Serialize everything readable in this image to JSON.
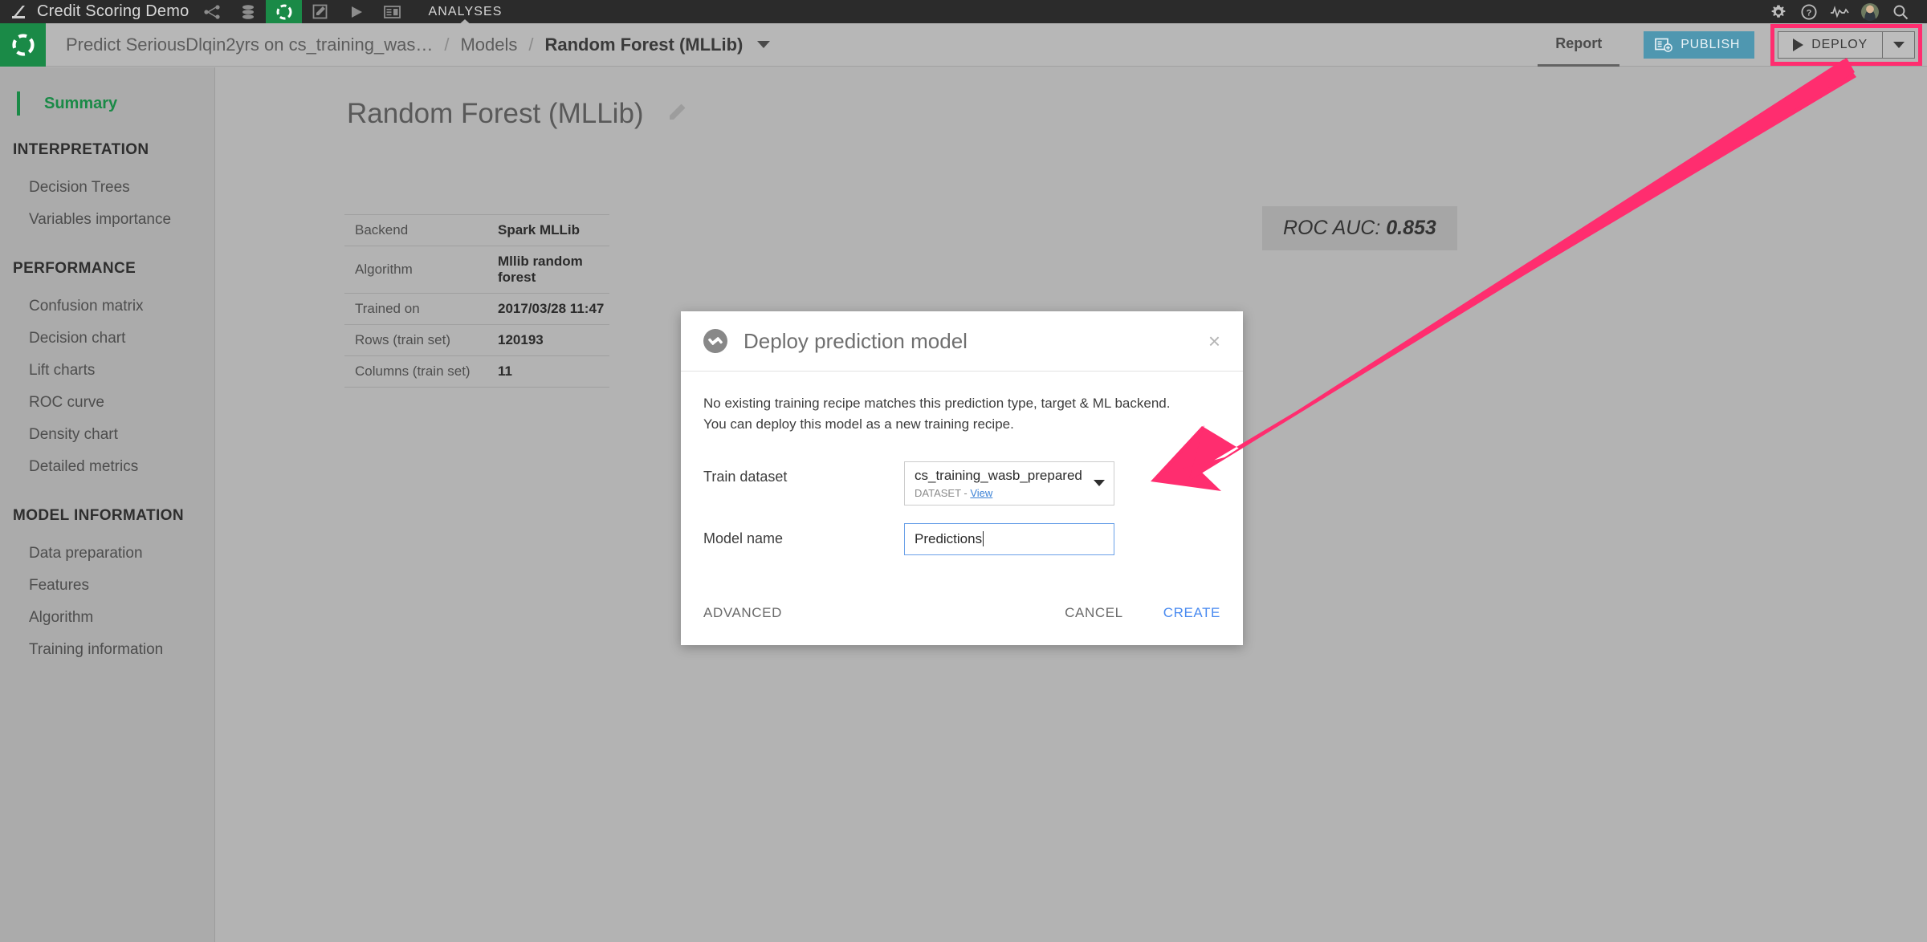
{
  "topbar": {
    "logo_icon": "dataiku-logo-icon",
    "project_name": "Credit Scoring Demo",
    "icons": [
      {
        "name": "flow-icon",
        "active": false
      },
      {
        "name": "datasets-icon",
        "active": false
      },
      {
        "name": "lab-analyses-icon",
        "active": true
      },
      {
        "name": "notebooks-icon",
        "active": false
      },
      {
        "name": "jobs-run-icon",
        "active": false
      },
      {
        "name": "dashboards-icon",
        "active": false
      }
    ],
    "section_label": "ANALYSES",
    "right_icons": [
      {
        "name": "gear-icon"
      },
      {
        "name": "help-icon"
      },
      {
        "name": "activity-icon"
      },
      {
        "name": "avatar"
      },
      {
        "name": "search-icon"
      }
    ]
  },
  "navbar": {
    "logo_icon": "project-logo-icon",
    "breadcrumb": {
      "analysis": "Predict SeriousDlqin2yrs on cs_training_was…",
      "separator": "/",
      "section": "Models",
      "current": "Random Forest (MLLib)"
    },
    "report_tab": "Report",
    "publish_label": "PUBLISH",
    "deploy_label": "DEPLOY",
    "highlight_color": "#ff2d6f",
    "publish_color": "#4f97b0"
  },
  "sidebar": {
    "active_item": "Summary",
    "groups": [
      {
        "header": "INTERPRETATION",
        "items": [
          "Decision Trees",
          "Variables importance"
        ]
      },
      {
        "header": "PERFORMANCE",
        "items": [
          "Confusion matrix",
          "Decision chart",
          "Lift charts",
          "ROC curve",
          "Density chart",
          "Detailed metrics"
        ]
      },
      {
        "header": "MODEL INFORMATION",
        "items": [
          "Data preparation",
          "Features",
          "Algorithm",
          "Training information"
        ]
      }
    ],
    "active_color": "#1a8a47"
  },
  "main": {
    "page_title": "Random Forest (MLLib)",
    "edit_icon": "pencil-icon",
    "info_table": {
      "rows": [
        {
          "key": "Backend",
          "value": "Spark MLLib"
        },
        {
          "key": "Algorithm",
          "value": "Mllib random forest"
        },
        {
          "key": "Trained on",
          "value": "2017/03/28 11:47"
        },
        {
          "key": "Rows (train set)",
          "value": "120193"
        },
        {
          "key": "Columns (train set)",
          "value": "11"
        }
      ]
    },
    "auc_badge": {
      "label": "ROC AUC:",
      "value": "0.853"
    }
  },
  "modal": {
    "icon": "deploy-model-icon",
    "title": "Deploy prediction model",
    "close_icon": "×",
    "message_line1": "No existing training recipe matches this prediction type, target & ML backend.",
    "message_line2": "You can deploy this model as a new training recipe.",
    "fields": [
      {
        "label": "Train dataset",
        "value": "cs_training_wasb_prepared",
        "sub_type": "DATASET -",
        "sub_link": "View",
        "control": "select"
      },
      {
        "label": "Model name",
        "value": "Predictions",
        "control": "text"
      }
    ],
    "advanced_label": "ADVANCED",
    "cancel_label": "CANCEL",
    "create_label": "CREATE",
    "create_color": "#4a8bf0"
  },
  "annotation": {
    "arrow_color": "#ff2d6f",
    "arrow_from": "deploy-button",
    "arrow_to": "deploy-prediction-model-dialog"
  }
}
